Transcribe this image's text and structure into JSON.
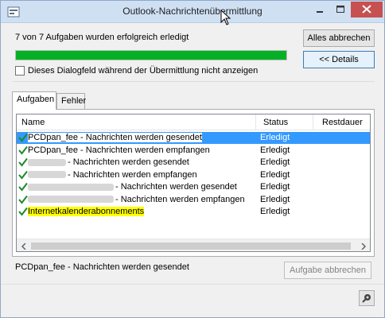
{
  "window": {
    "title": "Outlook-Nachrichtenübermittlung",
    "app_icon": "outlook-send-receive-icon",
    "controls": [
      "minimize-icon",
      "maximize-icon",
      "close-icon"
    ]
  },
  "summary": {
    "status_text": "7 von 7 Aufgaben wurden erfolgreich erledigt",
    "progress": 1.0,
    "progress_color": "#06b025"
  },
  "buttons": {
    "cancel_all": "Alles abbrechen",
    "details": "<< Details",
    "abort_task": "Aufgabe abbrechen"
  },
  "checkbox": {
    "label": "Dieses Dialogfeld während der Übermittlung nicht anzeigen",
    "checked": false
  },
  "tabs": [
    {
      "label": "Aufgaben",
      "active": true
    },
    {
      "label": "Fehler",
      "active": false
    }
  ],
  "task_list": {
    "columns": [
      "Name",
      "Status",
      "Restdauer"
    ],
    "rows": [
      {
        "name": "PCDpan_fee - Nachrichten werden gesendet",
        "status": "Erledigt",
        "selected": true
      },
      {
        "name": "PCDpan_fee - Nachrichten werden empfangen",
        "status": "Erledigt"
      },
      {
        "name": "- Nachrichten werden gesendet",
        "status": "Erledigt",
        "redacted": "short"
      },
      {
        "name": "- Nachrichten werden empfangen",
        "status": "Erledigt",
        "redacted": "short"
      },
      {
        "name": "- Nachrichten werden gesendet",
        "status": "Erledigt",
        "redacted": "long"
      },
      {
        "name": "- Nachrichten werden empfangen",
        "status": "Erledigt",
        "redacted": "long"
      },
      {
        "name": "Internetkalenderabonnements",
        "status": "Erledigt",
        "highlight": true
      }
    ]
  },
  "current_task": "PCDpan_fee - Nachrichten werden gesendet",
  "colors": {
    "selection": "#3399ff",
    "highlight": "#ffff00",
    "check": "#1a8a2a"
  }
}
